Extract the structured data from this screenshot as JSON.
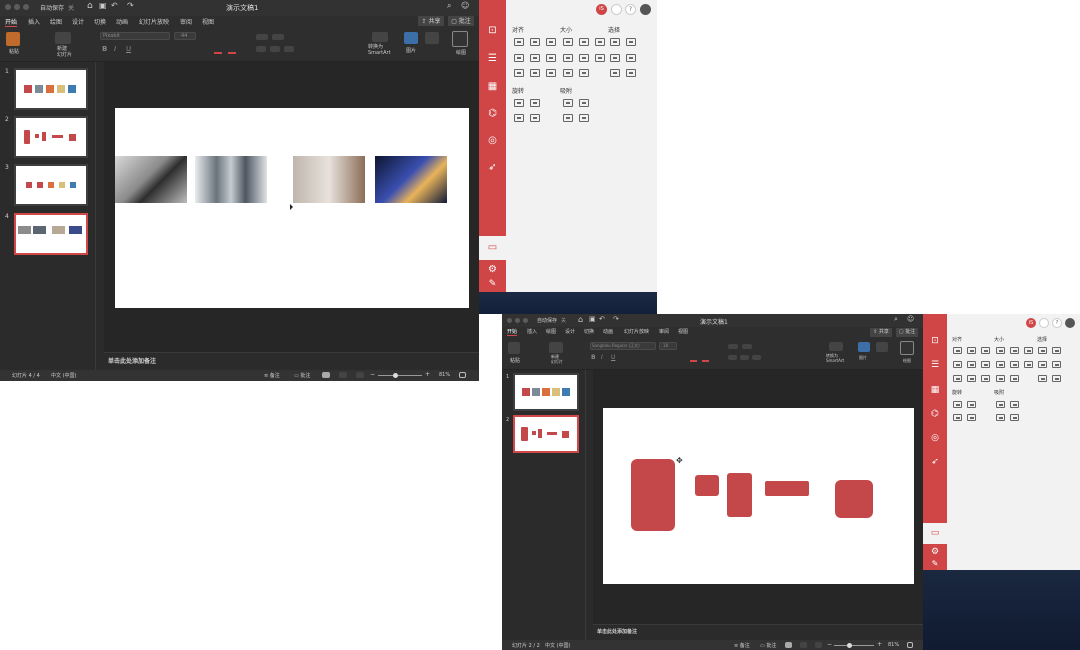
{
  "win1": {
    "autosave": "自动保存",
    "toggle": "关",
    "title": "演示文稿1",
    "share": "共享",
    "comment": "批注",
    "tabs": [
      "开始",
      "插入",
      "绘图",
      "设计",
      "切换",
      "动画",
      "幻灯片放映",
      "审阅",
      "视图"
    ],
    "ribbon_font": "Pixabit",
    "ribbon_size": "44",
    "labels": {
      "paste": "粘贴",
      "new_slide": "新建\n幻灯片",
      "smartart": "转换为\nSmartArt",
      "picture": "图片",
      "design": "绘图"
    },
    "notes": "单击此处添加备注",
    "status": {
      "slide": "幻灯片 4 / 4",
      "lang": "中文 (中国)",
      "notes_btn": "备注",
      "comments_btn": "批注",
      "zoom": "81%"
    },
    "thumb_nums": [
      "1",
      "2",
      "3",
      "4"
    ]
  },
  "win2": {
    "autosave": "自动保存",
    "toggle": "关",
    "title": "演示文稿1",
    "share": "共享",
    "comment": "批注",
    "tabs": [
      "开始",
      "插入",
      "绘图",
      "设计",
      "切换",
      "动画",
      "幻灯片放映",
      "审阅",
      "视图"
    ],
    "ribbon_font": "Sangbleu Regular (正文)",
    "ribbon_size": "18",
    "labels": {
      "paste": "粘贴",
      "new_slide": "新建\n幻灯片",
      "smartart": "转换为\nSmartArt",
      "picture": "图片",
      "design": "绘图"
    },
    "notes": "单击此处添加备注",
    "status": {
      "slide": "幻灯片 2 / 2",
      "lang": "中文 (中国)",
      "notes_btn": "备注",
      "comments_btn": "批注",
      "zoom": "81%"
    },
    "thumb_nums": [
      "1",
      "2"
    ]
  },
  "panel1": {
    "avatar": "iS",
    "sections": {
      "align": "对齐",
      "size": "大小",
      "select": "选择",
      "rotate": "旋转",
      "snap": "吸附"
    }
  },
  "panel2": {
    "avatar": "iS",
    "sections": {
      "align": "对齐",
      "size": "大小",
      "select": "选择",
      "rotate": "旋转",
      "snap": "吸附"
    }
  },
  "colors": {
    "brand_red": "#d04647",
    "shape_red": "#c4474a",
    "swatch_gray": "#7a8a96",
    "swatch_orange": "#d86f3c",
    "swatch_yellow": "#d8c07a",
    "swatch_blue": "#3e7bb0"
  }
}
